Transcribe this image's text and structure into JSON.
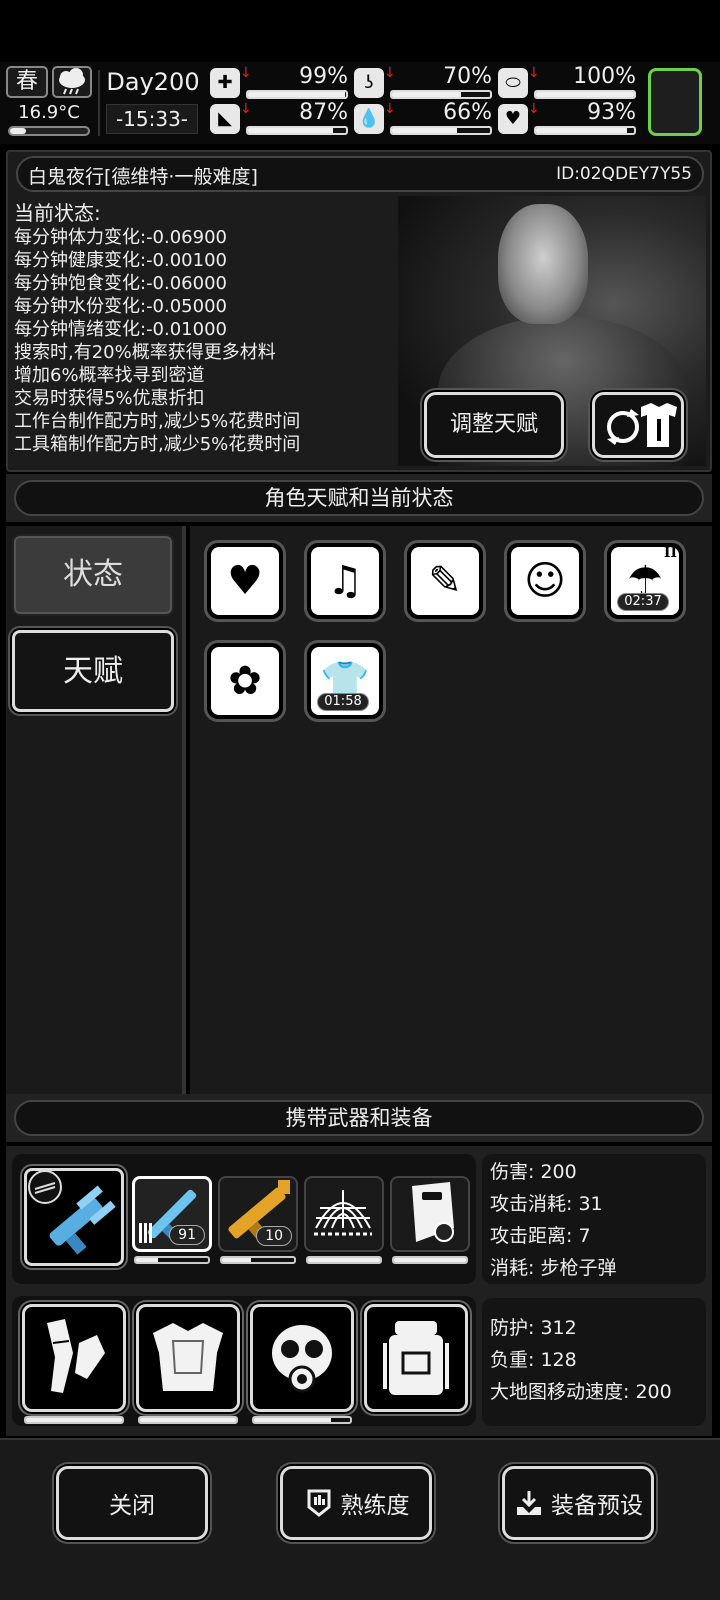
{
  "hud": {
    "season": "春",
    "temperature": "16.9°C",
    "temperature_level": 0.2,
    "day": "Day200",
    "time": "-15:33-",
    "stats": [
      {
        "name": "health",
        "icon": "medkit-icon",
        "value": "99%",
        "level": 0.99
      },
      {
        "name": "stomach",
        "icon": "stomach-icon",
        "value": "70%",
        "level": 0.7
      },
      {
        "name": "pill",
        "icon": "pill-icon",
        "value": "100%",
        "level": 1.0
      },
      {
        "name": "stamina",
        "icon": "boot-icon",
        "value": "87%",
        "level": 0.87
      },
      {
        "name": "water",
        "icon": "water-drop-icon",
        "value": "66%",
        "level": 0.66
      },
      {
        "name": "mood",
        "icon": "heart-icon",
        "value": "93%",
        "level": 0.93
      }
    ]
  },
  "character": {
    "name": "白鬼夜行[德维特·一般难度]",
    "id": "ID:02QDEY7Y55",
    "status_header": "当前状态:",
    "status_lines": [
      "每分钟体力变化:-0.06900",
      "每分钟健康变化:-0.00100",
      "每分钟饱食变化:-0.06000",
      "每分钟水份变化:-0.05000",
      "每分钟情绪变化:-0.01000",
      "搜索时,有20%概率获得更多材料",
      "增加6%概率找寻到密道",
      "交易时获得5%优惠折扣",
      "工作台制作配方时,减少5%花费时间",
      "工具箱制作配方时,减少5%花费时间"
    ],
    "adjust_talent_label": "调整天赋"
  },
  "talent_section_title": "角色天赋和当前状态",
  "tabs": {
    "status": "状态",
    "talent": "天赋"
  },
  "status_icons": [
    {
      "icon": "heart-icon",
      "glyph": "♥"
    },
    {
      "icon": "music-heart-icon",
      "glyph": "♫"
    },
    {
      "icon": "clipboard-bandage-icon",
      "glyph": "✎"
    },
    {
      "icon": "person-heartbeat-icon",
      "glyph": "☺"
    },
    {
      "icon": "umbrella-icon",
      "glyph": "☂",
      "timer": "02:37",
      "badge": "II"
    },
    {
      "icon": "stomach-germ-icon",
      "glyph": "✿"
    },
    {
      "icon": "shirt-icon",
      "glyph": "👕",
      "timer": "01:58"
    }
  ],
  "equipment_section_title": "携带武器和装备",
  "weapons": [
    {
      "icon": "minigun-icon",
      "bar": 0
    },
    {
      "icon": "blue-rifle-icon",
      "count": "91",
      "bar": 0.3
    },
    {
      "icon": "gold-rifle-icon",
      "count": "10",
      "bar": 0.4
    },
    {
      "icon": "net-icon",
      "bar": 1.0
    },
    {
      "icon": "riot-shield-icon",
      "bar": 1.0
    }
  ],
  "weapon_stats": [
    "伤害: 200",
    "攻击消耗: 31",
    "攻击距离: 7",
    "消耗: 步枪子弹"
  ],
  "armor": [
    {
      "icon": "gauntlets-icon",
      "bar": 1.0
    },
    {
      "icon": "body-armor-icon",
      "bar": 1.0
    },
    {
      "icon": "gas-mask-icon",
      "bar": 0.8
    },
    {
      "icon": "backpack-icon"
    }
  ],
  "armor_stats": [
    "防护: 312",
    "负重: 128",
    "大地图移动速度: 200"
  ],
  "buttons": {
    "close": "关闭",
    "proficiency": "熟练度",
    "preset": "装备预设"
  }
}
